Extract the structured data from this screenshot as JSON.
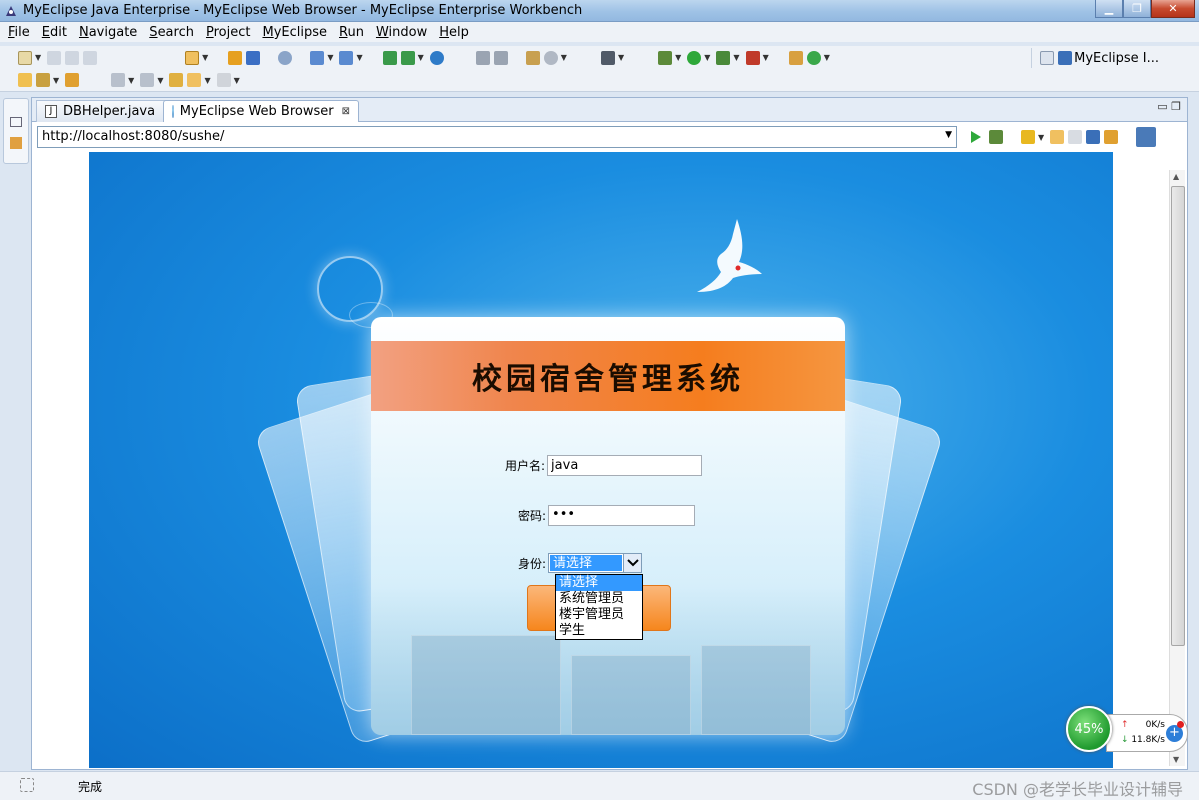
{
  "window": {
    "title": "MyEclipse Java Enterprise - MyEclipse Web Browser - MyEclipse Enterprise Workbench"
  },
  "menu": [
    {
      "label": "File",
      "u": "F",
      "rest": "ile"
    },
    {
      "label": "Edit",
      "u": "E",
      "rest": "dit"
    },
    {
      "label": "Navigate",
      "u": "N",
      "rest": "avigate"
    },
    {
      "label": "Search",
      "u": "S",
      "rest": "earch"
    },
    {
      "label": "Project",
      "u": "P",
      "rest": "roject"
    },
    {
      "label": "MyEclipse",
      "u": "M",
      "rest": "yEclipse"
    },
    {
      "label": "Run",
      "u": "R",
      "rest": "un"
    },
    {
      "label": "Window",
      "u": "W",
      "rest": "indow"
    },
    {
      "label": "Help",
      "u": "H",
      "rest": "elp"
    }
  ],
  "perspective": {
    "label": "MyEclipse I..."
  },
  "tabs": [
    {
      "label": "DBHelper.java",
      "icon": "java-file-icon"
    },
    {
      "label": "MyEclipse Web Browser",
      "icon": "globe-icon"
    }
  ],
  "browser": {
    "url": "http://localhost:8080/sushe/"
  },
  "login": {
    "title": "校园宿舍管理系统",
    "username_label": "用户名:",
    "username_value": "java",
    "password_label": "密码:",
    "password_value": "•••",
    "role_label": "身份:",
    "role_selected": "请选择",
    "role_options": [
      "请选择",
      "系统管理员",
      "楼宇管理员",
      "学生"
    ]
  },
  "status": {
    "text": "完成",
    "watermark": "CSDN @老学长毕业设计辅导"
  },
  "net_widget": {
    "cpu_percent": "45%",
    "upload": "0K/s",
    "download": "11.8K/s"
  },
  "colors": {
    "banner_orange": "#f57d1e",
    "page_blue": "#1a8de0",
    "select_highlight": "#3399ff"
  }
}
